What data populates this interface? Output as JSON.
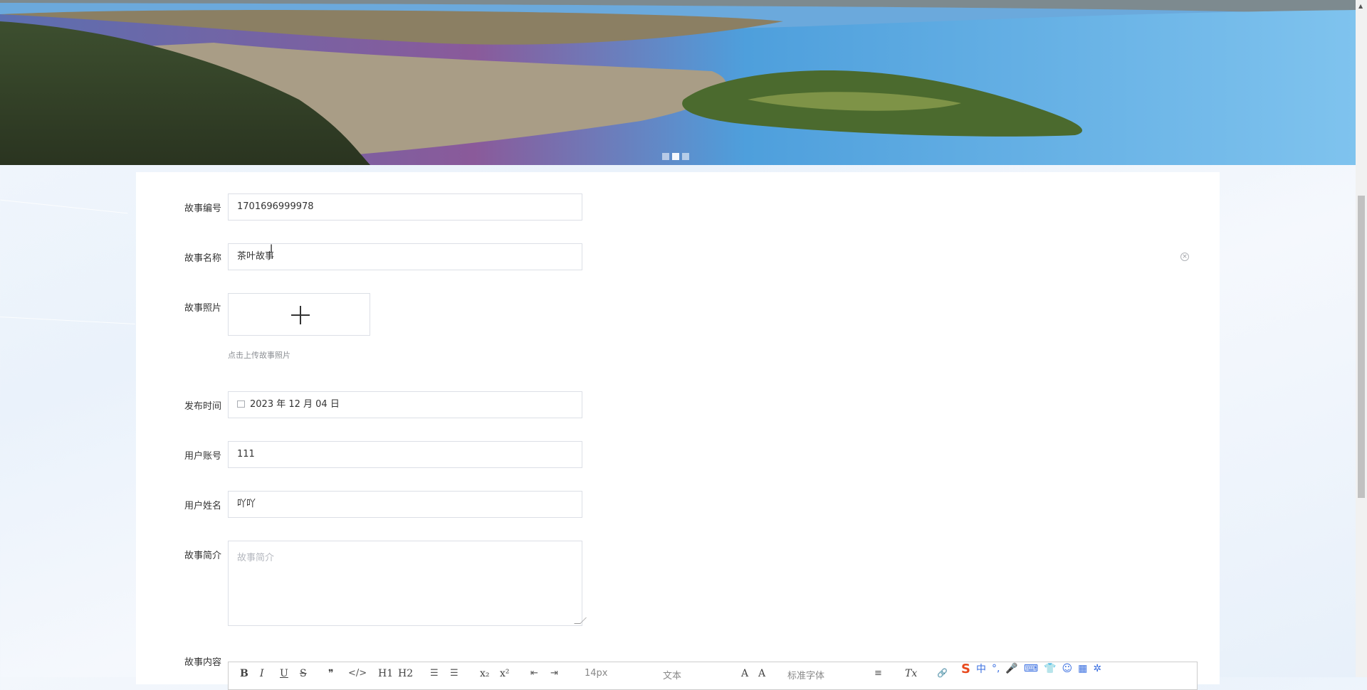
{
  "banner": {
    "slides": 3,
    "active_slide": 1
  },
  "form": {
    "story_no": {
      "label": "故事编号",
      "value": "1701696999978"
    },
    "story_name": {
      "label": "故事名称",
      "value": "茶叶故事",
      "clear_icon": "circle-x-icon"
    },
    "story_photo": {
      "label": "故事照片",
      "upload_icon": "plus-icon",
      "hint": "点击上传故事照片"
    },
    "publish_time": {
      "label": "发布时间",
      "value": "2023 年 12 月 04 日",
      "icon": "calendar-icon"
    },
    "user_account": {
      "label": "用户账号",
      "value": "111"
    },
    "user_name": {
      "label": "用户姓名",
      "value": "吖吖"
    },
    "story_intro": {
      "label": "故事简介",
      "placeholder": "故事简介"
    },
    "story_content": {
      "label": "故事内容"
    }
  },
  "editor_toolbar": {
    "bold": "B",
    "italic": "I",
    "underline": "U",
    "strike": "S",
    "quote": "❞",
    "code": "</>",
    "h1": "H1",
    "h2": "H2",
    "ordered_list": "☰",
    "bullet_list": "☰",
    "sub": "x₂",
    "sup": "x²",
    "outdent": "⇤",
    "indent": "⇥",
    "font_size": "14px",
    "heading_select": "文本",
    "font_family": "标准字体",
    "color": "A",
    "background": "A",
    "align": "≡",
    "clean": "Tx",
    "link": "🔗"
  },
  "ime_bar": {
    "logo": "S",
    "mode": "中",
    "items": [
      "°,",
      "🎤",
      "⌨",
      "👕",
      "☺",
      "▦",
      "✲"
    ]
  },
  "colors": {
    "border": "#dcdfe6",
    "placeholder": "#b5b8bf",
    "ime_blue": "#3a6fe0",
    "ime_logo": "#e8491d"
  }
}
